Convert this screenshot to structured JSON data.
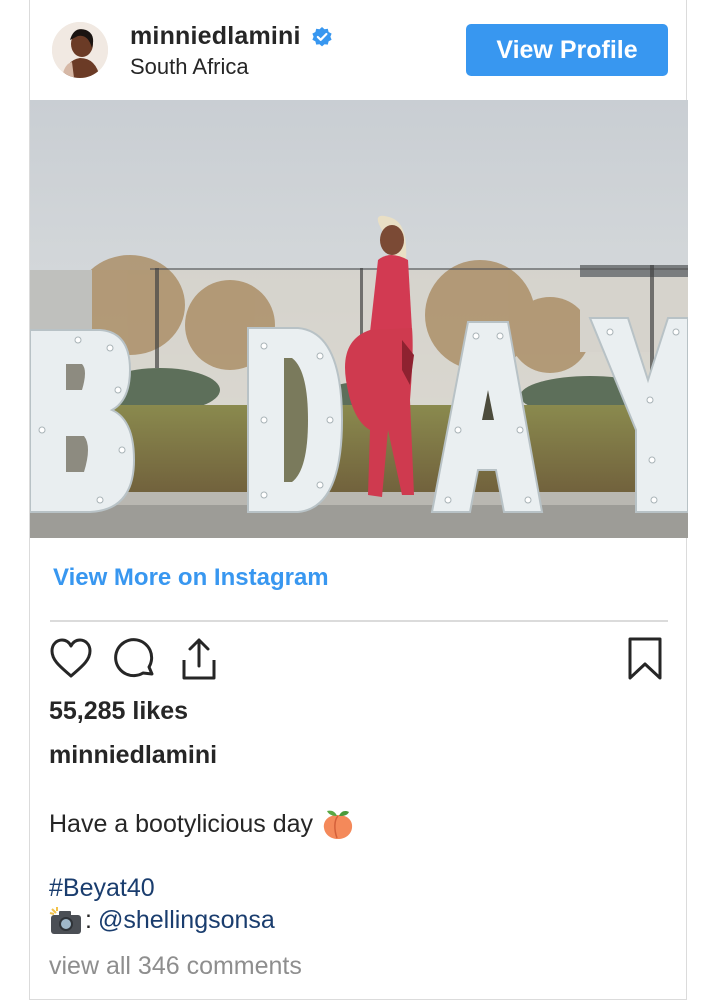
{
  "header": {
    "username": "minniedlamini",
    "location": "South Africa",
    "view_profile_label": "View Profile"
  },
  "photo": {
    "letters": [
      "B",
      "D",
      "A",
      "Y"
    ]
  },
  "view_more_label": "View More on Instagram",
  "actions": {
    "icons": [
      "heart-icon",
      "comment-icon",
      "share-icon",
      "bookmark-icon"
    ]
  },
  "likes": "55,285 likes",
  "caption_user": "minniedlamini",
  "caption_text": "Have a bootylicious day",
  "hashtag": "#Beyat40",
  "credit_separator": ":",
  "credit_mention": "@shellingsonsa",
  "comments_link": "view all 346 comments",
  "colors": {
    "accent": "#3897f0",
    "link": "#1a3d6e",
    "muted": "#8e8e8e",
    "text": "#262626",
    "dress": "#d23a52"
  }
}
